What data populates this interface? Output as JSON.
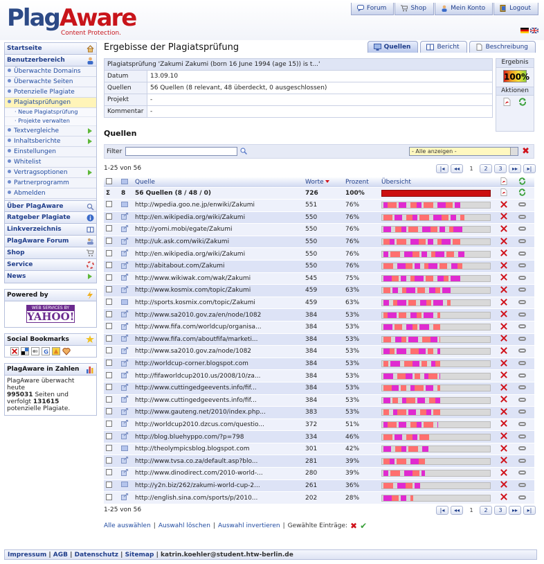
{
  "header": {
    "logo_part1": "Plag",
    "logo_part2": "Aware",
    "tagline": "Content Protection.",
    "tabs": [
      {
        "label": "Forum",
        "icon": "speech-bubble-icon"
      },
      {
        "label": "Shop",
        "icon": "cart-icon"
      },
      {
        "label": "Mein Konto",
        "icon": "user-icon"
      },
      {
        "label": "Logout",
        "icon": "door-icon"
      }
    ]
  },
  "sidebar": {
    "startseite": "Startseite",
    "benutzerbereich": "Benutzerbereich",
    "items": [
      {
        "label": "Überwachte Domains",
        "arrow": false
      },
      {
        "label": "Überwachte Seiten",
        "arrow": false
      },
      {
        "label": "Potenzielle Plagiate",
        "arrow": false
      },
      {
        "label": "Plagiatsprüfungen",
        "arrow": false,
        "active": true
      },
      {
        "label": "Textvergleiche",
        "arrow": true
      },
      {
        "label": "Inhaltsberichte",
        "arrow": true
      },
      {
        "label": "Einstellungen",
        "arrow": false
      },
      {
        "label": "Whitelist",
        "arrow": false
      },
      {
        "label": "Vertragsoptionen",
        "arrow": true
      },
      {
        "label": "Partnerprogramm",
        "arrow": false
      },
      {
        "label": "Abmelden",
        "arrow": false
      }
    ],
    "subitems": [
      "· Neue Plagiatsprüfung",
      "· Projekte verwalten"
    ],
    "sections": [
      {
        "label": "Über PlagAware",
        "icon": "search-icon"
      },
      {
        "label": "Ratgeber Plagiate",
        "icon": "info-icon"
      },
      {
        "label": "Linkverzeichnis",
        "icon": "book-icon"
      },
      {
        "label": "PlagAware Forum",
        "icon": "people-icon"
      },
      {
        "label": "Shop",
        "icon": "cart-icon"
      },
      {
        "label": "Service",
        "icon": "lifebuoy-icon"
      },
      {
        "label": "News",
        "icon": "arrow-right-icon"
      }
    ],
    "powered_by": "Powered by",
    "yahoo_small": "WEB SERVICES BY",
    "yahoo_big": "YAHOO!",
    "social": "Social Bookmarks",
    "stats_title": "PlagAware in Zahlen",
    "stats_line1": "PlagAware überwacht heute",
    "stats_num1": "995031",
    "stats_line2": " Seiten und verfolgt ",
    "stats_num2": "131615",
    "stats_line3": " potenzielle Plagiate."
  },
  "main": {
    "title": "Ergebisse der Plagiatsprüfung",
    "tabs": [
      {
        "label": "Quellen",
        "icon": "monitor-icon"
      },
      {
        "label": "Bericht",
        "icon": "book-icon"
      },
      {
        "label": "Beschreibung",
        "icon": "document-icon"
      }
    ],
    "info": {
      "heading": "Plagiatsprüfung 'Zakumi Zakumi (born 16 June 1994 (age 15)) is t...'",
      "rows": [
        {
          "label": "Datum",
          "value": "13.09.10"
        },
        {
          "label": "Quellen",
          "value": "56 Quellen (8 relevant, 48 überdeckt, 0 ausgeschlossen)"
        },
        {
          "label": "Projekt",
          "value": "-"
        },
        {
          "label": "Kommentar",
          "value": "-"
        }
      ],
      "ergebnis_label": "Ergebnis",
      "ergebnis_value": "100%",
      "aktionen_label": "Aktionen"
    },
    "quellen_title": "Quellen",
    "filter_label": "Filter",
    "filter_value": "",
    "select_value": "- Alle anzeigen -",
    "count_text": "1-25 von 56",
    "pages": [
      "1",
      "2",
      "3"
    ],
    "columns": {
      "quelle": "Quelle",
      "worte": "Worte",
      "prozent": "Prozent",
      "uebersicht": "Übersicht"
    },
    "summary": {
      "sigma": "Σ",
      "count": "8",
      "label": "56 Quellen (8 / 48 / 0)",
      "worte": "726",
      "prozent": "100%"
    },
    "rows": [
      {
        "url": "http://wpedia.goo.ne.jp/enwiki/Zakumi",
        "worte": "551",
        "prozent": "76%",
        "type": "page"
      },
      {
        "url": "http://en.wikipedia.org/wiki/Zakumi",
        "worte": "550",
        "prozent": "76%",
        "type": "copy"
      },
      {
        "url": "http://yomi.mobi/egate/Zakumi",
        "worte": "550",
        "prozent": "76%",
        "type": "copy"
      },
      {
        "url": "http://uk.ask.com/wiki/Zakumi",
        "worte": "550",
        "prozent": "76%",
        "type": "copy"
      },
      {
        "url": "http://en.wikipedia.org/wiki/Zakumi",
        "worte": "550",
        "prozent": "76%",
        "type": "copy"
      },
      {
        "url": "http://abitabout.com/Zakumi",
        "worte": "550",
        "prozent": "76%",
        "type": "copy"
      },
      {
        "url": "http://www.wikiwak.com/wak/Zakumi",
        "worte": "545",
        "prozent": "75%",
        "type": "copy"
      },
      {
        "url": "http://www.kosmix.com/topic/Zakumi",
        "worte": "459",
        "prozent": "63%",
        "type": "copy"
      },
      {
        "url": "http://sports.kosmix.com/topic/Zakumi",
        "worte": "459",
        "prozent": "63%",
        "type": "page"
      },
      {
        "url": "http://www.sa2010.gov.za/en/node/1082",
        "worte": "384",
        "prozent": "53%",
        "type": "copy"
      },
      {
        "url": "http://www.fifa.com/worldcup/organisa...",
        "worte": "384",
        "prozent": "53%",
        "type": "copy"
      },
      {
        "url": "http://www.fifa.com/aboutfifa/marketi...",
        "worte": "384",
        "prozent": "53%",
        "type": "copy"
      },
      {
        "url": "http://www.sa2010.gov.za/node/1082",
        "worte": "384",
        "prozent": "53%",
        "type": "copy"
      },
      {
        "url": "http://worldcup-corner.blogspot.com",
        "worte": "384",
        "prozent": "53%",
        "type": "copy"
      },
      {
        "url": "http://fifaworldcup2010.us/2008/10/za...",
        "worte": "384",
        "prozent": "53%",
        "type": "copy"
      },
      {
        "url": "http://www.cuttingedgeevents.info/fif...",
        "worte": "384",
        "prozent": "53%",
        "type": "copy"
      },
      {
        "url": "http://www.cuttingedgeevents.info/fif...",
        "worte": "384",
        "prozent": "53%",
        "type": "copy"
      },
      {
        "url": "http://www.gauteng.net/2010/index.php...",
        "worte": "383",
        "prozent": "53%",
        "type": "copy"
      },
      {
        "url": "http://worldcup2010.dzcus.com/questio...",
        "worte": "372",
        "prozent": "51%",
        "type": "copy"
      },
      {
        "url": "http://blog.bluehyppo.com/?p=798",
        "worte": "334",
        "prozent": "46%",
        "type": "copy"
      },
      {
        "url": "http://theolympicsblog.blogspot.com",
        "worte": "301",
        "prozent": "42%",
        "type": "page"
      },
      {
        "url": "http://www.tvsa.co.za/default.asp?blo...",
        "worte": "281",
        "prozent": "39%",
        "type": "copy"
      },
      {
        "url": "http://www.dinodirect.com/2010-world-...",
        "worte": "280",
        "prozent": "39%",
        "type": "copy"
      },
      {
        "url": "http://y2n.biz/262/zakumi-world-cup-2...",
        "worte": "261",
        "prozent": "36%",
        "type": "page"
      },
      {
        "url": "http://english.sina.com/sports/p/2010...",
        "worte": "202",
        "prozent": "28%",
        "type": "copy"
      }
    ],
    "actions": {
      "select_all": "Alle auswählen",
      "clear": "Auswahl löschen",
      "invert": "Auswahl invertieren",
      "selected": "Gewählte Einträge:"
    }
  },
  "footer": {
    "links": [
      "Impressum",
      "AGB",
      "Datenschutz",
      "Sitemap"
    ],
    "email": "katrin.koehler@student.htw-berlin.de"
  },
  "colors": {
    "brand_blue": "#2d4a86",
    "brand_red": "#c8141a",
    "bar_colors": [
      "#f5e23a",
      "#e02ad0",
      "#8fd34a",
      "#6a7be0",
      "#ff6f6f",
      "#6fd0e0"
    ]
  }
}
